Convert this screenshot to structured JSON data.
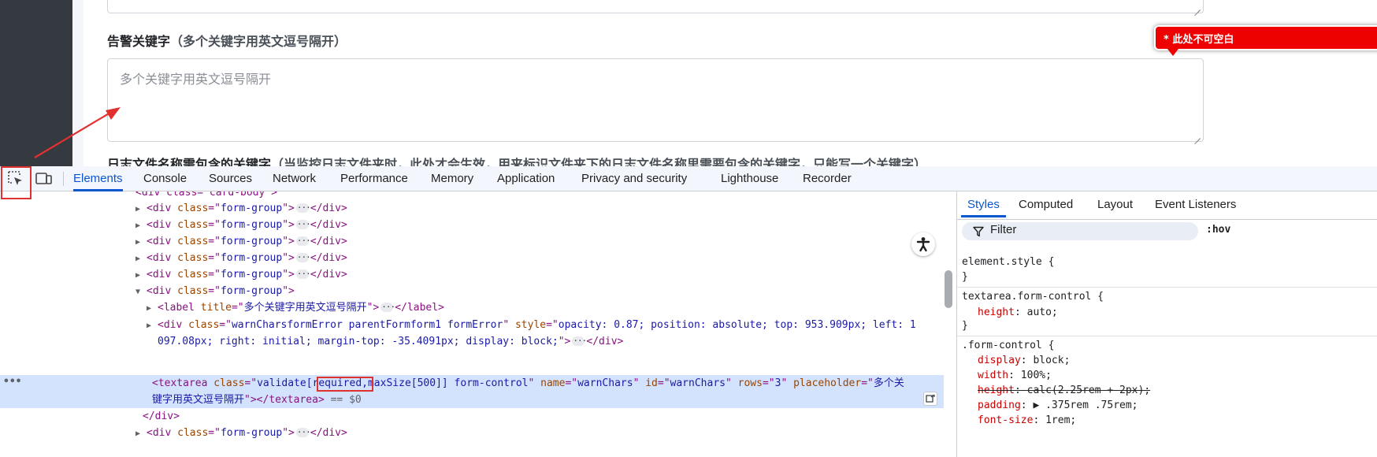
{
  "page": {
    "warn_label_main": "告警关键字",
    "warn_label_sub": "（多个关键字用英文逗号隔开）",
    "warn_placeholder": "多个关键字用英文逗号隔开",
    "next_label_main": "日志文件名称需包含的关键字",
    "next_label_sub": "（当监控日志文件夹时，此处才会生效，用来标识文件夹下的日志文件名称里需要包含的关键字，只能写一个关键字）",
    "error_tip": "* 此处不可空白"
  },
  "devtools": {
    "tabs": [
      {
        "label": "Elements",
        "active": true
      },
      {
        "label": "Console"
      },
      {
        "label": "Sources"
      },
      {
        "label": "Network"
      },
      {
        "label": "Performance"
      },
      {
        "label": "Memory"
      },
      {
        "label": "Application"
      },
      {
        "label": "Privacy and security"
      },
      {
        "label": "Lighthouse"
      },
      {
        "label": "Recorder"
      }
    ],
    "dom": {
      "top_partial": "<div class=\"card-body\">",
      "form_group": "form-group",
      "label_title": "多个关键字用英文逗号隔开",
      "warn_div_class": "warnCharsformError parentFormform1 formError",
      "warn_div_style_1": "opacity: 0.87; position: absolute; top: 953.909px; left: 1",
      "warn_div_style_2": "097.08px; right: initial; margin-top: -35.4091px; display: block;",
      "textarea_class_pre": "validate[",
      "textarea_required": "required,",
      "textarea_class_post": "maxSize[500]] form-control",
      "textarea_name": "warnChars",
      "textarea_id": "warnChars",
      "textarea_rows": "3",
      "textarea_placeholder_1": "多个关",
      "textarea_placeholder_2": "键字用英文逗号隔开",
      "eq_marker": "== $0"
    },
    "styles": {
      "tabs": [
        {
          "label": "Styles",
          "active": true
        },
        {
          "label": "Computed"
        },
        {
          "label": "Layout"
        },
        {
          "label": "Event Listeners"
        }
      ],
      "filter_placeholder": "Filter",
      "hov": ":hov",
      "rules": [
        {
          "selector": "element.style {",
          "close": "}"
        },
        {
          "selector": "textarea.form-control {",
          "props": [
            {
              "name": "height",
              "value": "auto;"
            }
          ],
          "close": "}"
        },
        {
          "selector": ".form-control {",
          "props": [
            {
              "name": "display",
              "value": "block;"
            },
            {
              "name": "width",
              "value": "100%;"
            },
            {
              "name": "height",
              "value": "calc(2.25rem + 2px);",
              "struck": true
            },
            {
              "name": "padding",
              "value": "▶ .375rem .75rem;"
            },
            {
              "name": "font-size",
              "value": "1rem;"
            }
          ]
        }
      ]
    }
  },
  "colors": {
    "accent": "#0b57d0",
    "annotation_red": "#e03131",
    "error_red": "#ee0101",
    "selection": "#d3e3fd"
  }
}
